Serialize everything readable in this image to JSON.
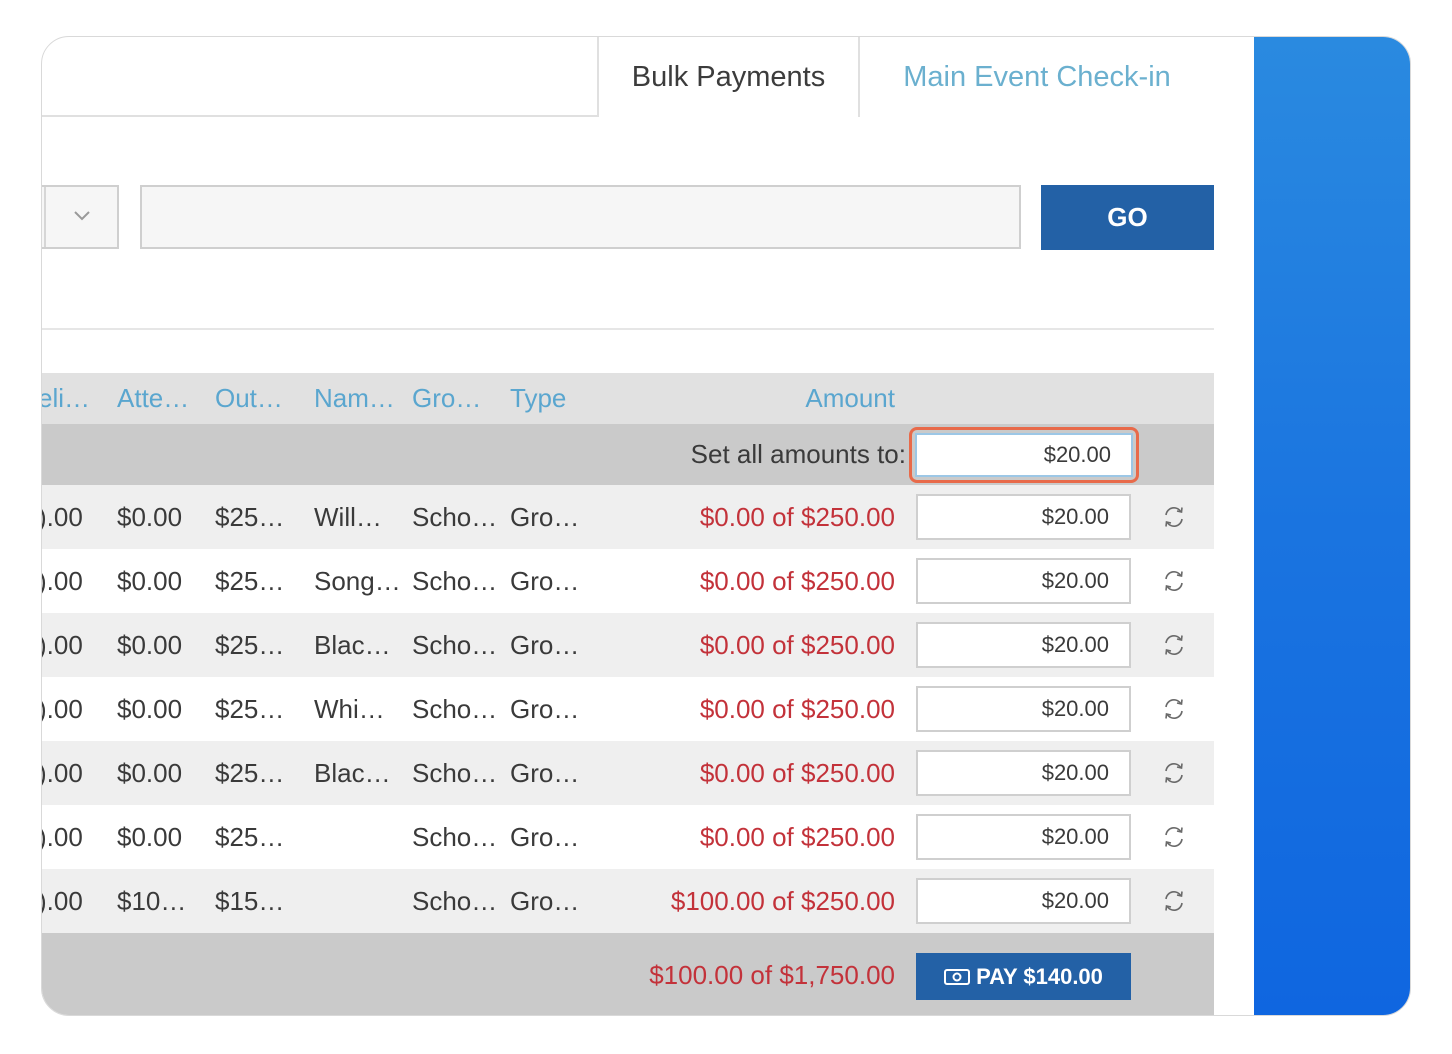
{
  "tabs": {
    "active": "Bulk Payments",
    "inactive": "Main Event Check-in"
  },
  "search": {
    "go_label": "GO",
    "value": ""
  },
  "table": {
    "headers": [
      "eli…",
      "Atte…",
      "Out…",
      "Nam…",
      "Gro…",
      "Type",
      "Amount"
    ],
    "set_all_label": "Set all amounts to:",
    "set_all_value": "$20.00",
    "rows": [
      {
        "c0": ").00",
        "c1": "$0.00",
        "c2": "$25…",
        "c3": "Will…",
        "c4": "Scho…",
        "c5": "Gro…",
        "amount": "$0.00 of $250.00",
        "input": "$20.00"
      },
      {
        "c0": ").00",
        "c1": "$0.00",
        "c2": "$25…",
        "c3": "Song…",
        "c4": "Scho…",
        "c5": "Gro…",
        "amount": "$0.00 of $250.00",
        "input": "$20.00"
      },
      {
        "c0": ").00",
        "c1": "$0.00",
        "c2": "$25…",
        "c3": "Blac…",
        "c4": "Scho…",
        "c5": "Gro…",
        "amount": "$0.00 of $250.00",
        "input": "$20.00"
      },
      {
        "c0": ").00",
        "c1": "$0.00",
        "c2": "$25…",
        "c3": "Whi…",
        "c4": "Scho…",
        "c5": "Gro…",
        "amount": "$0.00 of $250.00",
        "input": "$20.00"
      },
      {
        "c0": ").00",
        "c1": "$0.00",
        "c2": "$25…",
        "c3": "Blac…",
        "c4": "Scho…",
        "c5": "Gro…",
        "amount": "$0.00 of $250.00",
        "input": "$20.00"
      },
      {
        "c0": ").00",
        "c1": "$0.00",
        "c2": "$25…",
        "c3": "",
        "c4": "Scho…",
        "c5": "Gro…",
        "amount": "$0.00 of $250.00",
        "input": "$20.00"
      },
      {
        "c0": ").00",
        "c1": "$10…",
        "c2": "$15…",
        "c3": "",
        "c4": "Scho…",
        "c5": "Gro…",
        "amount": "$100.00 of $250.00",
        "input": "$20.00"
      }
    ],
    "total": "$100.00 of $1,750.00",
    "pay_label": "PAY $140.00"
  },
  "colors": {
    "accent": "#2361a6",
    "header_text": "#5aa6cf",
    "amount_red": "#c3323a",
    "focus_ring": "#e86a4a"
  },
  "icons": [
    "chevron-down-icon",
    "refresh-icon",
    "cash-icon"
  ]
}
